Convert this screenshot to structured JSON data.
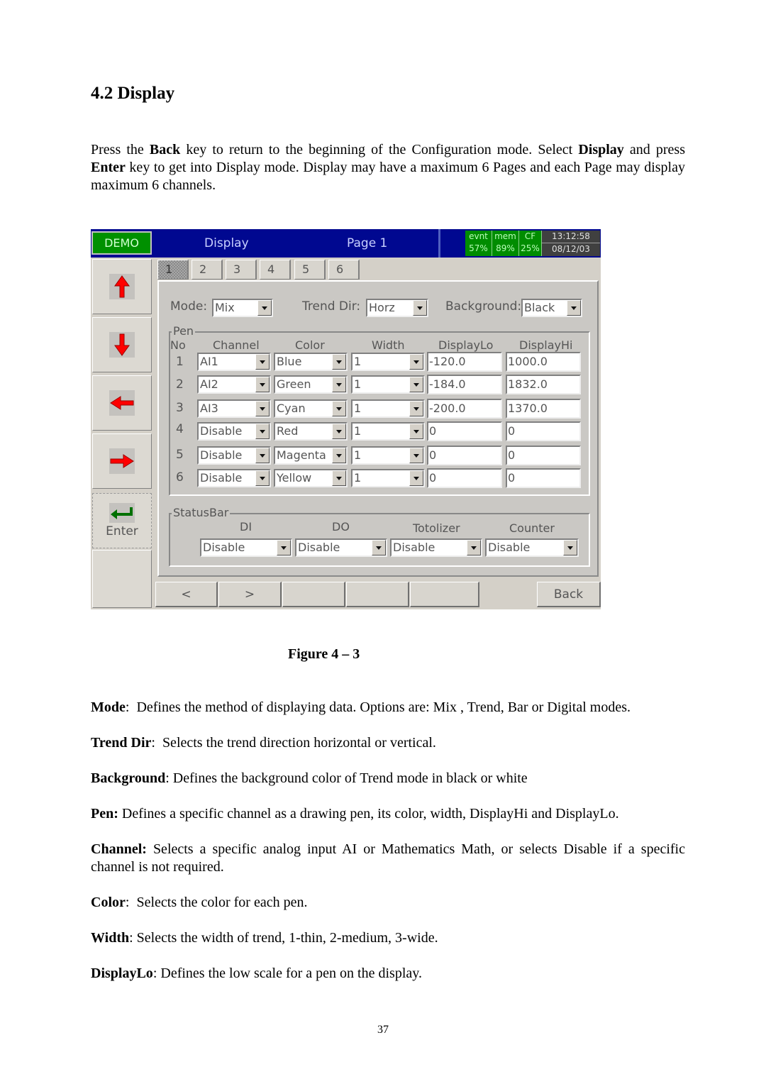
{
  "section_heading": "4.2  Display",
  "intro": {
    "parts": [
      {
        "t": "Press the ",
        "b": false
      },
      {
        "t": "Back",
        "b": true
      },
      {
        "t": " key to return to the beginning of the Configuration mode. Select ",
        "b": false
      },
      {
        "t": "Display",
        "b": true
      },
      {
        "t": " and press ",
        "b": false
      },
      {
        "t": "Enter",
        "b": true
      },
      {
        "t": " key to get into Display mode.  Display may have a maximum 6 Pages and each Page may display maximum 6 channels.",
        "b": false
      }
    ]
  },
  "screen": {
    "mode_badge": "DEMO",
    "title": "Display",
    "page_label": "Page 1",
    "status": [
      {
        "label": "evnt",
        "value": "57%"
      },
      {
        "label": "mem",
        "value": "89%"
      },
      {
        "label": "CF",
        "value": "25%"
      }
    ],
    "time": "13:12:58",
    "date": "08/12/03",
    "colors": {
      "titlebar": "#000890",
      "status_green": "#008c00",
      "arrow_red": "#ff0000",
      "enter_green": "#007000"
    },
    "side_buttons": [
      {
        "icon": "arrow-up-icon",
        "label": ""
      },
      {
        "icon": "arrow-down-icon",
        "label": ""
      },
      {
        "icon": "arrow-left-icon",
        "label": ""
      },
      {
        "icon": "arrow-right-icon",
        "label": ""
      },
      {
        "icon": "enter-icon",
        "label": "Enter"
      }
    ],
    "tabs": [
      "1",
      "2",
      "3",
      "4",
      "5",
      "6"
    ],
    "active_tab": "1",
    "mode": {
      "label": "Mode:",
      "value": "Mix"
    },
    "trend_dir": {
      "label": "Trend Dir:",
      "value": "Horz"
    },
    "background": {
      "label": "Background:",
      "value": "Black"
    },
    "pen_group": {
      "legend": "Pen",
      "headers": {
        "no": "No",
        "channel": "Channel",
        "color": "Color",
        "width": "Width",
        "display_lo": "DisplayLo",
        "display_hi": "DisplayHi"
      },
      "rows": [
        {
          "no": "1",
          "channel": "AI1",
          "color": "Blue",
          "width": "1",
          "display_lo": "-120.0",
          "display_hi": "1000.0"
        },
        {
          "no": "2",
          "channel": "AI2",
          "color": "Green",
          "width": "1",
          "display_lo": "-184.0",
          "display_hi": "1832.0"
        },
        {
          "no": "3",
          "channel": "AI3",
          "color": "Cyan",
          "width": "1",
          "display_lo": "-200.0",
          "display_hi": "1370.0"
        },
        {
          "no": "4",
          "channel": "Disable",
          "color": "Red",
          "width": "1",
          "display_lo": "0",
          "display_hi": "0"
        },
        {
          "no": "5",
          "channel": "Disable",
          "color": "Magenta",
          "width": "1",
          "display_lo": "0",
          "display_hi": "0"
        },
        {
          "no": "6",
          "channel": "Disable",
          "color": "Yellow",
          "width": "1",
          "display_lo": "0",
          "display_hi": "0"
        }
      ]
    },
    "statusbar_group": {
      "legend": "StatusBar",
      "fields": [
        {
          "label": "DI",
          "value": "Disable"
        },
        {
          "label": "DO",
          "value": "Disable"
        },
        {
          "label": "Totolizer",
          "value": "Disable"
        },
        {
          "label": "Counter",
          "value": "Disable"
        }
      ]
    },
    "bottom_buttons": [
      "<",
      ">",
      "",
      "",
      "",
      "Back"
    ]
  },
  "caption": "Figure 4  –  3",
  "definitions": [
    {
      "term": "Mode",
      "sep": ":  ",
      "text": "Defines the method of displaying data.  Options are: Mix , Trend, Bar or Digital modes."
    },
    {
      "term": "Trend Dir",
      "sep": ":  ",
      "text": "Selects the trend direction horizontal or vertical."
    },
    {
      "term": "Background",
      "sep": ": ",
      "text": "Defines the background color of Trend mode in black or white"
    },
    {
      "term": "Pen:",
      "sep": " ",
      "text": "Defines a specific channel as a drawing pen, its color, width, DisplayHi and DisplayLo."
    },
    {
      "term": "Channel:",
      "sep": " ",
      "text": "Selects a specific analog input AI or Mathematics Math, or selects Disable if a specific channel is not required."
    },
    {
      "term": "Color",
      "sep": ":  ",
      "text": "Selects the color for each pen."
    },
    {
      "term": "Width",
      "sep": ": ",
      "text": "Selects the width of trend, 1-thin, 2-medium, 3-wide."
    },
    {
      "term": "DisplayLo",
      "sep": ": ",
      "text": "Defines the low scale for a pen on the display."
    }
  ],
  "page_number": "37"
}
